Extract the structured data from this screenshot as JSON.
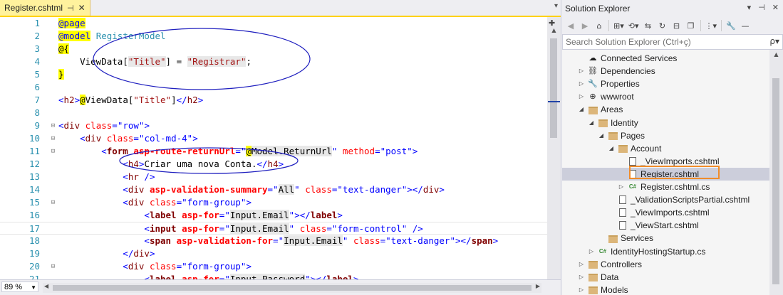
{
  "editor": {
    "tab": {
      "title": "Register.cshtml",
      "pin": "⊣",
      "close": "✕"
    },
    "zoom": "89 %",
    "lines": [
      {
        "n": "1",
        "fold": "",
        "tokens": [
          {
            "t": "@page",
            "c": "kw rz"
          }
        ]
      },
      {
        "n": "2",
        "fold": "",
        "tokens": [
          {
            "t": "@model",
            "c": "kw rz"
          },
          {
            "t": " ",
            "c": "tx"
          },
          {
            "t": "RegisterModel",
            "c": "ty"
          }
        ]
      },
      {
        "n": "3",
        "fold": "",
        "tokens": [
          {
            "t": "@{",
            "c": "tx rz"
          }
        ]
      },
      {
        "n": "4",
        "fold": "",
        "tokens": [
          {
            "t": "    ViewData[",
            "c": "tx"
          },
          {
            "t": "\"Title\"",
            "c": "st hl"
          },
          {
            "t": "] = ",
            "c": "tx"
          },
          {
            "t": "\"Registrar\"",
            "c": "st hl"
          },
          {
            "t": ";",
            "c": "tx"
          }
        ]
      },
      {
        "n": "5",
        "fold": "",
        "tokens": [
          {
            "t": "}",
            "c": "tx rz"
          }
        ]
      },
      {
        "n": "6",
        "fold": "",
        "tokens": []
      },
      {
        "n": "7",
        "fold": "",
        "tokens": [
          {
            "t": "<",
            "c": "kw"
          },
          {
            "t": "h2",
            "c": "tg"
          },
          {
            "t": ">",
            "c": "kw"
          },
          {
            "t": "@",
            "c": "tx rz"
          },
          {
            "t": "ViewData[",
            "c": "tx"
          },
          {
            "t": "\"Title\"",
            "c": "st"
          },
          {
            "t": "]",
            "c": "tx"
          },
          {
            "t": "</",
            "c": "kw"
          },
          {
            "t": "h2",
            "c": "tg"
          },
          {
            "t": ">",
            "c": "kw"
          }
        ]
      },
      {
        "n": "8",
        "fold": "",
        "tokens": []
      },
      {
        "n": "9",
        "fold": "⊟",
        "tokens": [
          {
            "t": "<",
            "c": "kw"
          },
          {
            "t": "div",
            "c": "tg"
          },
          {
            "t": " ",
            "c": "tx"
          },
          {
            "t": "class",
            "c": "at"
          },
          {
            "t": "=",
            "c": "kw"
          },
          {
            "t": "\"row\"",
            "c": "kw"
          },
          {
            "t": ">",
            "c": "kw"
          }
        ]
      },
      {
        "n": "10",
        "fold": "⊟",
        "tokens": [
          {
            "t": "    <",
            "c": "kw"
          },
          {
            "t": "div",
            "c": "tg"
          },
          {
            "t": " ",
            "c": "tx"
          },
          {
            "t": "class",
            "c": "at"
          },
          {
            "t": "=",
            "c": "kw"
          },
          {
            "t": "\"col-md-4\"",
            "c": "kw"
          },
          {
            "t": ">",
            "c": "kw"
          }
        ]
      },
      {
        "n": "11",
        "fold": "⊟",
        "tokens": [
          {
            "t": "        <",
            "c": "kw"
          },
          {
            "t": "form",
            "c": "tg b"
          },
          {
            "t": " ",
            "c": "tx"
          },
          {
            "t": "asp-route-returnUrl",
            "c": "at b"
          },
          {
            "t": "=",
            "c": "kw"
          },
          {
            "t": "\"",
            "c": "kw"
          },
          {
            "t": "@",
            "c": "tx rz"
          },
          {
            "t": "Model.ReturnUrl",
            "c": "tx hl"
          },
          {
            "t": "\"",
            "c": "kw"
          },
          {
            "t": " ",
            "c": "tx"
          },
          {
            "t": "method",
            "c": "at"
          },
          {
            "t": "=",
            "c": "kw"
          },
          {
            "t": "\"post\"",
            "c": "kw"
          },
          {
            "t": ">",
            "c": "kw"
          }
        ]
      },
      {
        "n": "12",
        "fold": "",
        "tokens": [
          {
            "t": "            <",
            "c": "kw"
          },
          {
            "t": "h4",
            "c": "tg"
          },
          {
            "t": ">",
            "c": "kw"
          },
          {
            "t": "Criar uma nova Conta.",
            "c": "tx"
          },
          {
            "t": "</",
            "c": "kw"
          },
          {
            "t": "h4",
            "c": "tg"
          },
          {
            "t": ">",
            "c": "kw"
          }
        ]
      },
      {
        "n": "13",
        "fold": "",
        "tokens": [
          {
            "t": "            <",
            "c": "kw"
          },
          {
            "t": "hr",
            "c": "tg"
          },
          {
            "t": " />",
            "c": "kw"
          }
        ]
      },
      {
        "n": "14",
        "fold": "",
        "tokens": [
          {
            "t": "            <",
            "c": "kw"
          },
          {
            "t": "div",
            "c": "tg"
          },
          {
            "t": " ",
            "c": "tx"
          },
          {
            "t": "asp-validation-summary",
            "c": "at b"
          },
          {
            "t": "=",
            "c": "kw"
          },
          {
            "t": "\"",
            "c": "kw"
          },
          {
            "t": "All",
            "c": "tx hl"
          },
          {
            "t": "\"",
            "c": "kw"
          },
          {
            "t": " ",
            "c": "tx"
          },
          {
            "t": "class",
            "c": "at"
          },
          {
            "t": "=",
            "c": "kw"
          },
          {
            "t": "\"text-danger\"",
            "c": "kw"
          },
          {
            "t": "></",
            "c": "kw"
          },
          {
            "t": "div",
            "c": "tg"
          },
          {
            "t": ">",
            "c": "kw"
          }
        ]
      },
      {
        "n": "15",
        "fold": "⊟",
        "tokens": [
          {
            "t": "            <",
            "c": "kw"
          },
          {
            "t": "div",
            "c": "tg"
          },
          {
            "t": " ",
            "c": "tx"
          },
          {
            "t": "class",
            "c": "at"
          },
          {
            "t": "=",
            "c": "kw"
          },
          {
            "t": "\"form-group\"",
            "c": "kw"
          },
          {
            "t": ">",
            "c": "kw"
          }
        ]
      },
      {
        "n": "16",
        "fold": "",
        "tokens": [
          {
            "t": "                <",
            "c": "kw"
          },
          {
            "t": "label",
            "c": "tg b"
          },
          {
            "t": " ",
            "c": "tx"
          },
          {
            "t": "asp-for",
            "c": "at b"
          },
          {
            "t": "=",
            "c": "kw"
          },
          {
            "t": "\"",
            "c": "kw"
          },
          {
            "t": "Input.Email",
            "c": "tx hl"
          },
          {
            "t": "\"",
            "c": "kw"
          },
          {
            "t": "></",
            "c": "kw"
          },
          {
            "t": "label",
            "c": "tg b"
          },
          {
            "t": ">",
            "c": "kw"
          }
        ]
      },
      {
        "n": "17",
        "fold": "",
        "cur": true,
        "tokens": [
          {
            "t": "                <",
            "c": "kw"
          },
          {
            "t": "input",
            "c": "tg b"
          },
          {
            "t": " ",
            "c": "tx"
          },
          {
            "t": "asp-for",
            "c": "at b"
          },
          {
            "t": "=",
            "c": "kw"
          },
          {
            "t": "\"",
            "c": "kw"
          },
          {
            "t": "Input.Email",
            "c": "tx hl"
          },
          {
            "t": "\"",
            "c": "kw"
          },
          {
            "t": " ",
            "c": "tx"
          },
          {
            "t": "class",
            "c": "at"
          },
          {
            "t": "=",
            "c": "kw"
          },
          {
            "t": "\"form-control\"",
            "c": "kw"
          },
          {
            "t": " />",
            "c": "kw"
          }
        ]
      },
      {
        "n": "18",
        "fold": "",
        "tokens": [
          {
            "t": "                <",
            "c": "kw"
          },
          {
            "t": "span",
            "c": "tg b"
          },
          {
            "t": " ",
            "c": "tx"
          },
          {
            "t": "asp-validation-for",
            "c": "at b"
          },
          {
            "t": "=",
            "c": "kw"
          },
          {
            "t": "\"",
            "c": "kw"
          },
          {
            "t": "Input.Email",
            "c": "tx hl"
          },
          {
            "t": "\"",
            "c": "kw"
          },
          {
            "t": " ",
            "c": "tx"
          },
          {
            "t": "class",
            "c": "at"
          },
          {
            "t": "=",
            "c": "kw"
          },
          {
            "t": "\"text-danger\"",
            "c": "kw"
          },
          {
            "t": "></",
            "c": "kw"
          },
          {
            "t": "span",
            "c": "tg b"
          },
          {
            "t": ">",
            "c": "kw"
          }
        ]
      },
      {
        "n": "19",
        "fold": "",
        "tokens": [
          {
            "t": "            </",
            "c": "kw"
          },
          {
            "t": "div",
            "c": "tg"
          },
          {
            "t": ">",
            "c": "kw"
          }
        ]
      },
      {
        "n": "20",
        "fold": "⊟",
        "tokens": [
          {
            "t": "            <",
            "c": "kw"
          },
          {
            "t": "div",
            "c": "tg"
          },
          {
            "t": " ",
            "c": "tx"
          },
          {
            "t": "class",
            "c": "at"
          },
          {
            "t": "=",
            "c": "kw"
          },
          {
            "t": "\"form-group\"",
            "c": "kw"
          },
          {
            "t": ">",
            "c": "kw"
          }
        ]
      },
      {
        "n": "21",
        "fold": "",
        "tokens": [
          {
            "t": "                <",
            "c": "kw"
          },
          {
            "t": "label",
            "c": "tg b"
          },
          {
            "t": " ",
            "c": "tx"
          },
          {
            "t": "asp-for",
            "c": "at b"
          },
          {
            "t": "=",
            "c": "kw"
          },
          {
            "t": "\"",
            "c": "kw"
          },
          {
            "t": "Input.Password",
            "c": "tx hl"
          },
          {
            "t": "\"",
            "c": "kw"
          },
          {
            "t": "></",
            "c": "kw"
          },
          {
            "t": "label",
            "c": "tg b"
          },
          {
            "t": ">",
            "c": "kw"
          }
        ]
      }
    ]
  },
  "solution_explorer": {
    "title": "Solution Explorer",
    "title_buttons": [
      "▾",
      "⊣",
      "✕"
    ],
    "toolbar": [
      {
        "icon": "back-icon",
        "glyph": "◀",
        "dim": true
      },
      {
        "icon": "forward-icon",
        "glyph": "▶",
        "dim": true
      },
      {
        "icon": "home-icon",
        "glyph": "⌂",
        "dim": false
      },
      {
        "icon": "switch-views-icon",
        "glyph": "⊞▾",
        "dim": false
      },
      {
        "icon": "pending-changes-icon",
        "glyph": "⟲▾",
        "dim": false
      },
      {
        "icon": "sync-icon",
        "glyph": "⇆",
        "dim": false
      },
      {
        "icon": "refresh-icon",
        "glyph": "↻",
        "dim": false
      },
      {
        "icon": "collapse-all-icon",
        "glyph": "⊟",
        "dim": false
      },
      {
        "icon": "show-all-files-icon",
        "glyph": "❐",
        "dim": false
      },
      {
        "icon": "preview-icon",
        "glyph": "⋮▾",
        "dim": false
      },
      {
        "icon": "properties-icon",
        "glyph": "🔧",
        "dim": false
      },
      {
        "icon": "auto-hide-icon",
        "glyph": "—",
        "dim": false
      }
    ],
    "search_placeholder": "Search Solution Explorer (Ctrl+ç)",
    "search_icon": "ρ▾",
    "tree": [
      {
        "label": "Connected Services",
        "depth": 1,
        "exp": "",
        "icon": "cloud-icon",
        "glyph": "☁"
      },
      {
        "label": "Dependencies",
        "depth": 1,
        "exp": "▷",
        "icon": "dependencies-icon",
        "glyph": "⛓"
      },
      {
        "label": "Properties",
        "depth": 1,
        "exp": "▷",
        "icon": "wrench-icon",
        "glyph": "🔧"
      },
      {
        "label": "wwwroot",
        "depth": 1,
        "exp": "▷",
        "icon": "globe-icon",
        "glyph": "⊕"
      },
      {
        "label": "Areas",
        "depth": 1,
        "exp": "◢",
        "icon": "folder-icon",
        "glyph": "folder"
      },
      {
        "label": "Identity",
        "depth": 2,
        "exp": "◢",
        "icon": "folder-icon",
        "glyph": "folder"
      },
      {
        "label": "Pages",
        "depth": 3,
        "exp": "◢",
        "icon": "folder-icon",
        "glyph": "folder"
      },
      {
        "label": "Account",
        "depth": 4,
        "exp": "◢",
        "icon": "folder-icon",
        "glyph": "folder"
      },
      {
        "label": "_ViewImports.cshtml",
        "depth": 5,
        "exp": "",
        "icon": "razor-file-icon",
        "glyph": "file"
      },
      {
        "label": "Register.cshtml",
        "depth": 5,
        "exp": "",
        "icon": "razor-file-icon",
        "glyph": "file",
        "selected": true
      },
      {
        "label": "Register.cshtml.cs",
        "depth": 5,
        "exp": "▷",
        "icon": "csharp-file-icon",
        "glyph": "cs"
      },
      {
        "label": "_ValidationScriptsPartial.cshtml",
        "depth": 4,
        "exp": "",
        "icon": "razor-file-icon",
        "glyph": "file"
      },
      {
        "label": "_ViewImports.cshtml",
        "depth": 4,
        "exp": "",
        "icon": "razor-file-icon",
        "glyph": "file"
      },
      {
        "label": "_ViewStart.cshtml",
        "depth": 4,
        "exp": "",
        "icon": "razor-file-icon",
        "glyph": "file"
      },
      {
        "label": "Services",
        "depth": 3,
        "exp": "",
        "icon": "folder-icon",
        "glyph": "folder"
      },
      {
        "label": "IdentityHostingStartup.cs",
        "depth": 2,
        "exp": "▷",
        "icon": "csharp-file-icon",
        "glyph": "cs"
      },
      {
        "label": "Controllers",
        "depth": 1,
        "exp": "▷",
        "icon": "folder-icon",
        "glyph": "folder"
      },
      {
        "label": "Data",
        "depth": 1,
        "exp": "▷",
        "icon": "folder-icon",
        "glyph": "folder"
      },
      {
        "label": "Models",
        "depth": 1,
        "exp": "▷",
        "icon": "folder-icon",
        "glyph": "folder"
      }
    ]
  },
  "colors": {
    "tab_active": "#fff29d",
    "tab_accent": "#ffd100",
    "razor_highlight": "#ffff00",
    "annotation_ellipse": "#1f1fbf",
    "selection_box": "#f08c2a",
    "selected_row": "#cccedb"
  }
}
